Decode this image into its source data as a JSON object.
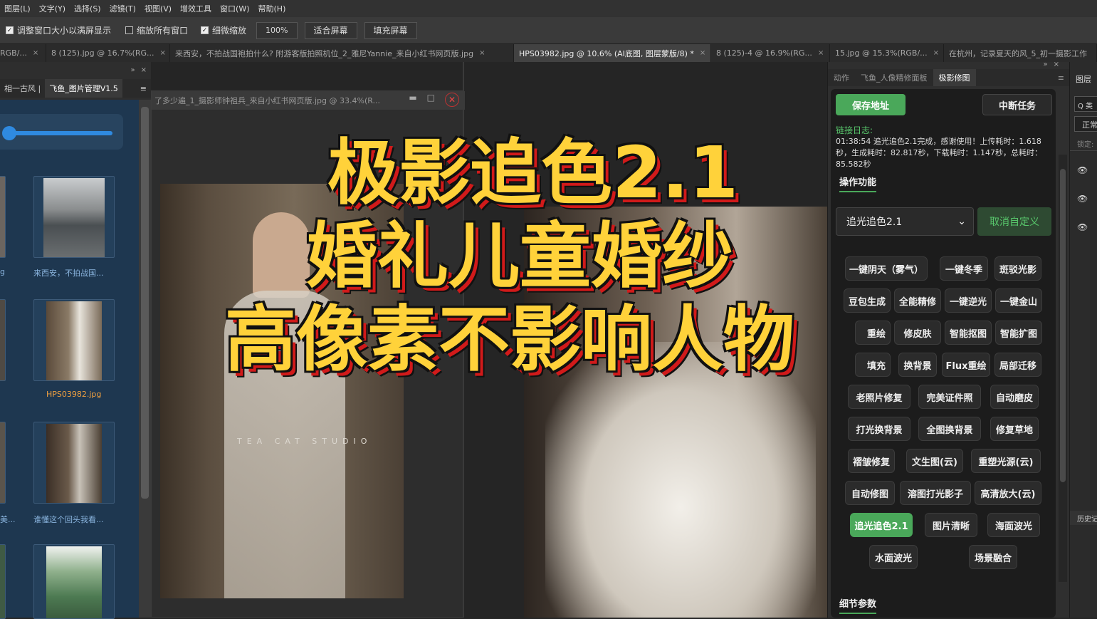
{
  "menu": [
    "图层(L)",
    "文字(Y)",
    "选择(S)",
    "滤镜(T)",
    "视图(V)",
    "增效工具",
    "窗口(W)",
    "帮助(H)"
  ],
  "options": {
    "resize_windows": "调整窗口大小以满屏显示",
    "zoom_all": "缩放所有窗口",
    "scrubby_zoom": "细微缩放",
    "zoom_value": "100%",
    "fit_screen": "适合屏幕",
    "fill_screen": "填充屏幕"
  },
  "doc_tabs": [
    {
      "label": "RGB/...",
      "close": "×"
    },
    {
      "label": "8 (125).jpg @ 16.7%(RG...",
      "close": "×"
    },
    {
      "label": "来西安，不拍战国袍拍什么? 附游客版拍照机位_2_雅尼Yannie_来自小红书网页版.jpg",
      "close": "×"
    },
    {
      "label": "HPS03982.jpg @ 10.6% (AI底图, 图层蒙版/8) *",
      "close": "×"
    },
    {
      "label": "8 (125)-4 @ 16.9%(RG...",
      "close": "×"
    },
    {
      "label": "15.jpg @ 15.3%(RGB/...",
      "close": "×"
    },
    {
      "label": "在杭州，记录夏天的风_5_初一摄影工作",
      "close": ""
    }
  ],
  "left_panel": {
    "tabs": [
      "相一古风 |",
      "飞鱼_图片管理V1.5"
    ],
    "menu_icon": "≡",
    "top_icons": [
      "»",
      "×"
    ],
    "items": [
      {
        "label": "来西安，不拍战国..."
      },
      {
        "label": "HPS03982.jpg",
        "highlight": true
      },
      {
        "label": "谁懂这个回头我看..."
      },
      {
        "label": ""
      }
    ],
    "left_cut_labels": [
      "g",
      "美..."
    ]
  },
  "float_window": {
    "title": "了多少遍_1_摄影师钟祖兵_来自小红书网页版.jpg @ 33.4%(R...",
    "min": "▬",
    "max": "□",
    "close": "✕"
  },
  "photo_watermark": "TEA  CAT  STUDIO",
  "overlay": {
    "line1": "极影追色2.1",
    "line2": "婚礼儿童婚纱",
    "line3": "高像素不影响人物"
  },
  "right_panel": {
    "tabs": [
      "动作",
      "飞鱼_人像精修面板",
      "极影修图"
    ],
    "top_icons": [
      "»",
      "×"
    ],
    "menu_icon": "≡",
    "save_btn": "保存地址",
    "stop_btn": "中断任务",
    "log_label": "链接日志:",
    "log_text": "01:38:54 追光追色2.1完成，感谢使用！上传耗时：1.618秒，生成耗时：82.817秒，下载耗时：1.147秒，总耗时：85.582秒",
    "ops_title": "操作功能",
    "select_value": "追光追色2.1",
    "select_arrow": "⌄",
    "cancel_btn": "取消自定义",
    "buttons": [
      [
        "一键阴天（雾气）",
        "一键冬季",
        "斑驳光影"
      ],
      [
        "豆包生成",
        "全能精修",
        "一键逆光",
        "一键金山"
      ],
      [
        "重绘",
        "修皮肤",
        "智能抠图",
        "智能扩图"
      ],
      [
        "填充",
        "换背景",
        "Flux重绘",
        "局部迁移"
      ],
      [
        "老照片修复",
        "完美证件照",
        "自动磨皮"
      ],
      [
        "打光换背景",
        "全图换背景",
        "修复草地"
      ],
      [
        "褶皱修复",
        "文生图(云)",
        "重塑光源(云)"
      ],
      [
        "自动修图",
        "溶图打光影子",
        "高清放大(云)"
      ],
      [
        "追光追色2.1",
        "图片清晰",
        "海面波光"
      ],
      [
        "水面波光",
        "场景融合"
      ]
    ],
    "detail_title": "细节参数"
  },
  "layers_panel": {
    "title": "图层",
    "search": "Q 类",
    "mode": "正常",
    "lock": "锁定:",
    "history": "历史记"
  }
}
